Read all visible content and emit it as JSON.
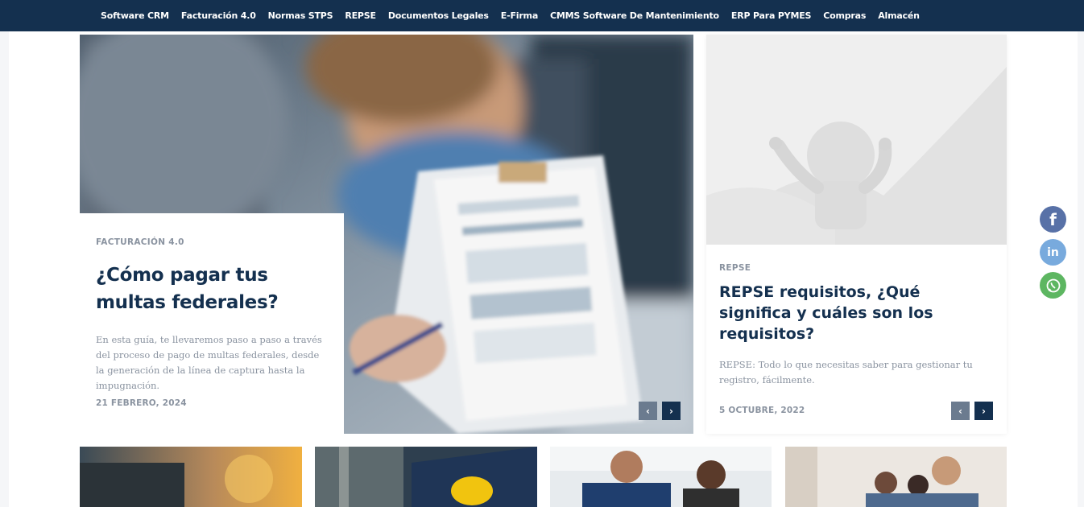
{
  "nav": {
    "items": [
      "Software CRM",
      "Facturación 4.0",
      "Normas STPS",
      "REPSE",
      "Documentos Legales",
      "E-Firma",
      "CMMS Software De Mantenimiento",
      "ERP Para PYMES",
      "Compras",
      "Almacén"
    ]
  },
  "featured": {
    "category": "FACTURACIÓN 4.0",
    "title": "¿Cómo pagar tus multas federales?",
    "excerpt": "En esta guía, te llevaremos paso a paso a través del proceso de pago de multas federales, desde la generación de la línea de captura hasta la impugnación.",
    "date": "21 FEBRERO, 2024",
    "prev_icon": "chevron-left-icon",
    "next_icon": "chevron-right-icon"
  },
  "side": {
    "category": "REPSE",
    "title": "REPSE requisitos, ¿Qué significa y cuáles son los requisitos?",
    "excerpt": "REPSE: Todo lo que necesitas saber para gestionar tu registro, fácilmente.",
    "date": "5 OCTUBRE, 2022"
  },
  "social": {
    "facebook_icon": "facebook-icon",
    "linkedin_icon": "linkedin-icon",
    "whatsapp_icon": "whatsapp-icon"
  },
  "colors": {
    "navy": "#14304f",
    "muted": "#8a93a0",
    "facebook": "#3b5998",
    "linkedin": "#0a66c2",
    "whatsapp": "#4caf50"
  }
}
